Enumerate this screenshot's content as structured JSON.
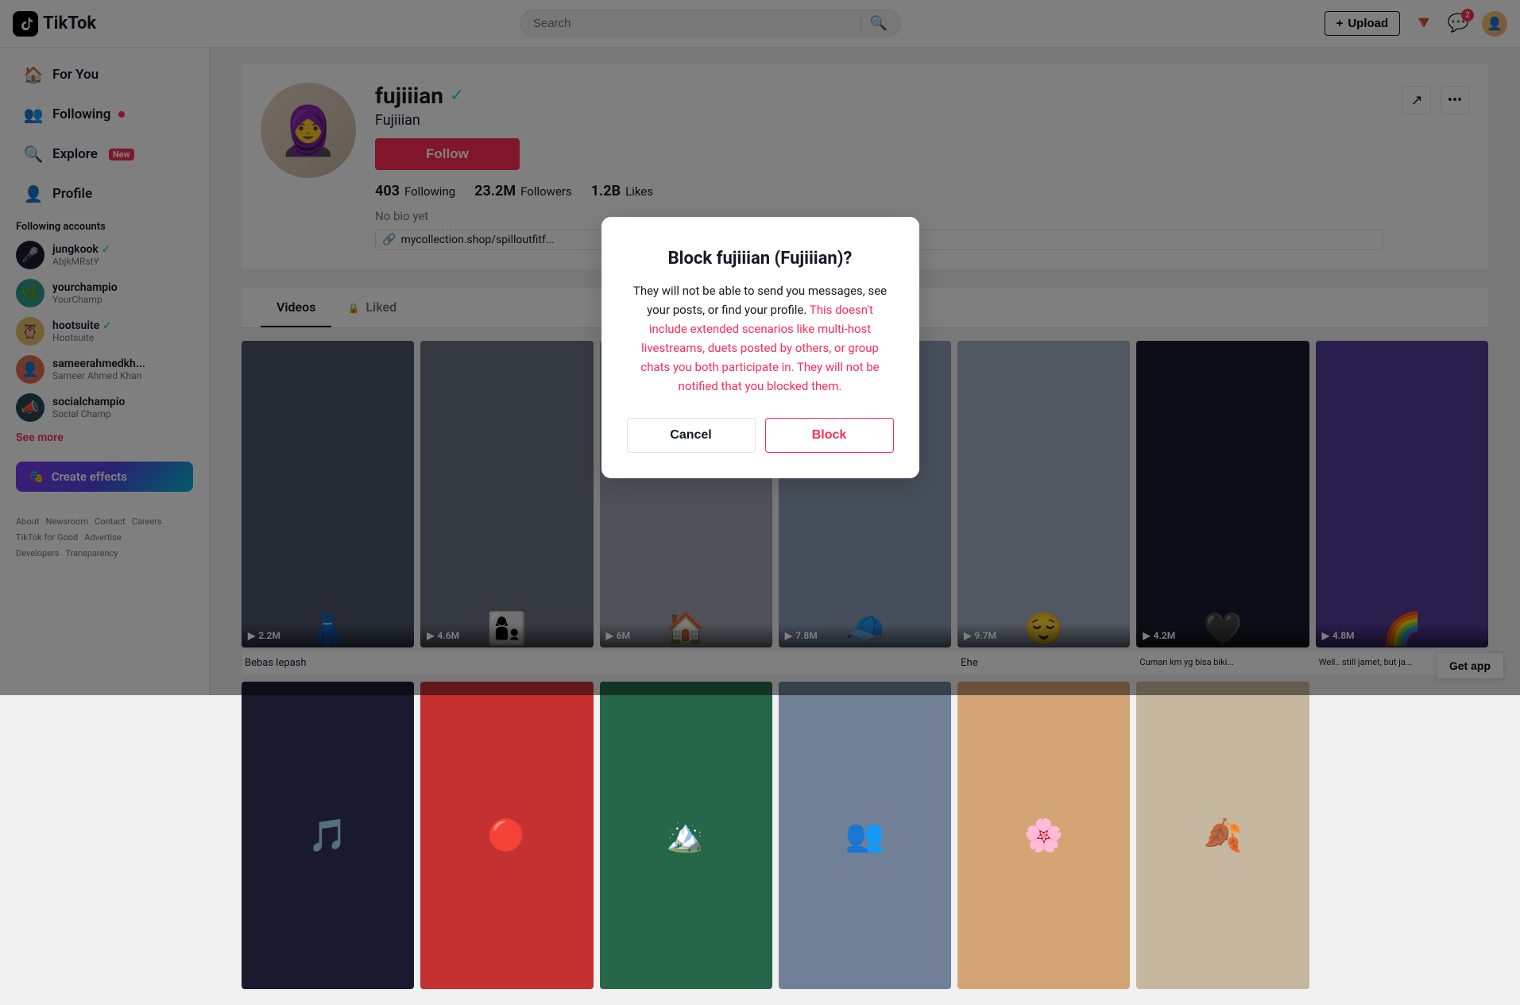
{
  "app": {
    "name": "TikTok",
    "logo_text": "TikTok"
  },
  "header": {
    "search_placeholder": "Search",
    "upload_label": "Upload",
    "inbox_badge": "2"
  },
  "nav": {
    "for_you": "For You",
    "following": "Following",
    "explore": "Explore",
    "explore_badge": "New",
    "profile": "Profile"
  },
  "sidebar": {
    "section_title": "Following accounts",
    "accounts": [
      {
        "name": "jungkook",
        "handle": "AbjkMRstY",
        "verified": true,
        "emoji": "🎤"
      },
      {
        "name": "yourchampio",
        "handle": "YourChamp",
        "verified": false,
        "emoji": "🌿"
      },
      {
        "name": "hootsuite",
        "handle": "Hootsuite",
        "verified": true,
        "emoji": "🦉"
      },
      {
        "name": "sameerahmedkh...",
        "handle": "Sameer Ahmed Khan",
        "verified": false,
        "emoji": "👤"
      },
      {
        "name": "socialchampio",
        "handle": "Social Champ",
        "verified": false,
        "emoji": "📣"
      }
    ],
    "see_more": "See more",
    "create_effects": "Create effects",
    "footer_links": [
      "About",
      "Newsroom",
      "Contact",
      "Careers",
      "TikTok for Good",
      "Advertise",
      "Developers",
      "Transparency"
    ]
  },
  "profile": {
    "username": "fujiiian",
    "display_name": "Fujiiian",
    "verified": true,
    "follow_label": "Follow",
    "stats": {
      "following_count": "403",
      "following_label": "Following",
      "followers_count": "23.2M",
      "followers_label": "Followers",
      "likes_count": "1.2B",
      "likes_label": "Likes"
    },
    "no_bio": "No bio yet",
    "link": "mycollection.shop/spilloutfitf...",
    "tabs": [
      {
        "label": "Videos",
        "active": true,
        "lock": false
      },
      {
        "label": "Liked",
        "active": false,
        "lock": true
      }
    ]
  },
  "videos": [
    {
      "views": "2.2M",
      "title": "Bebas lepash",
      "bg": "#4a5568",
      "emoji": "👗"
    },
    {
      "views": "4.6M",
      "title": "",
      "bg": "#718096",
      "emoji": "👶"
    },
    {
      "views": "6M",
      "title": "",
      "bg": "#9ca3af",
      "emoji": "🏠"
    },
    {
      "views": "7.8M",
      "title": "",
      "bg": "#6b7280",
      "emoji": "🧢"
    },
    {
      "views": "9.7M",
      "title": "Ehe",
      "bg": "#a0aec0",
      "emoji": "😌"
    },
    {
      "views": "4.2M",
      "title": "Cuman km yg bisa biki...",
      "bg": "#1a1a2e",
      "emoji": "🖤"
    },
    {
      "views": "4.8M",
      "title": "Well.. still jamet, but ja...",
      "bg": "#553c9a",
      "emoji": "🌈"
    },
    {
      "views": "",
      "title": "",
      "bg": "#1a1a2e",
      "emoji": "🎵"
    },
    {
      "views": "",
      "title": "",
      "bg": "#e53e3e",
      "emoji": "🔴"
    },
    {
      "views": "",
      "title": "",
      "bg": "#2d6a4f",
      "emoji": "🏔️"
    },
    {
      "views": "",
      "title": "",
      "bg": "#6b7280",
      "emoji": "👥"
    },
    {
      "views": "",
      "title": "",
      "bg": "#d4a574",
      "emoji": "🌸"
    },
    {
      "views": "",
      "title": "",
      "bg": "#2d3748",
      "emoji": "🍂"
    }
  ],
  "modal": {
    "title": "Block fujiiian (Fujiiian)?",
    "body_part1": "They will not be able to send you messages, see your posts, or find your profile.",
    "body_part2": "This doesn't include extended scenarios like multi-host livestreams, duets posted by others, or group chats you both participate in. They will not be notified that you blocked them.",
    "cancel_label": "Cancel",
    "block_label": "Block"
  },
  "get_app": "Get app"
}
